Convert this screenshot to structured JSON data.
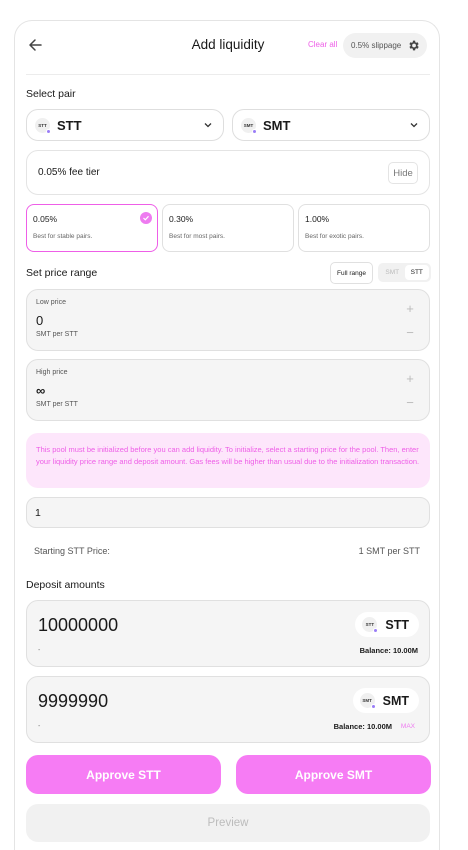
{
  "header": {
    "title": "Add liquidity",
    "clear_all": "Clear all",
    "slippage": "0.5% slippage"
  },
  "pair": {
    "label": "Select pair",
    "token_a": {
      "symbol": "STT",
      "logo_text": "STT"
    },
    "token_b": {
      "symbol": "SMT",
      "logo_text": "SMT"
    }
  },
  "fee": {
    "selected_text": "0.05% fee tier",
    "hide_label": "Hide",
    "tiers": [
      {
        "pct": "0.05%",
        "desc": "Best for stable pairs.",
        "selected": true
      },
      {
        "pct": "0.30%",
        "desc": "Best for most pairs.",
        "selected": false
      },
      {
        "pct": "1.00%",
        "desc": "Best for exotic pairs.",
        "selected": false
      }
    ]
  },
  "price_range": {
    "label": "Set price range",
    "full_range": "Full range",
    "toggle": [
      "SMT",
      "STT"
    ],
    "toggle_active": "STT",
    "low": {
      "label": "Low price",
      "value": "0",
      "unit": "SMT per STT"
    },
    "high": {
      "label": "High price",
      "value": "∞",
      "unit": "SMT per STT"
    }
  },
  "warning": "This pool must be initialized before you can add liquidity. To initialize, select a starting price for the pool. Then, enter your liquidity price range and deposit amount. Gas fees will be higher than usual due to the initialization transaction.",
  "starting_price": {
    "input_value": "1",
    "label": "Starting STT Price:",
    "value": "1 SMT per STT"
  },
  "deposit": {
    "label": "Deposit amounts",
    "a": {
      "amount": "10000000",
      "usd": "-",
      "symbol": "STT",
      "logo_text": "STT",
      "balance": "Balance: 10.00M"
    },
    "b": {
      "amount": "9999990",
      "usd": "-",
      "symbol": "SMT",
      "logo_text": "SMT",
      "balance": "Balance: 10.00M",
      "max": "MAX"
    }
  },
  "buttons": {
    "approve_a": "Approve STT",
    "approve_b": "Approve SMT",
    "preview": "Preview"
  },
  "colors": {
    "accent": "#ee5ee7",
    "button": "#f67cf4",
    "warning_bg": "#fde6fb"
  }
}
